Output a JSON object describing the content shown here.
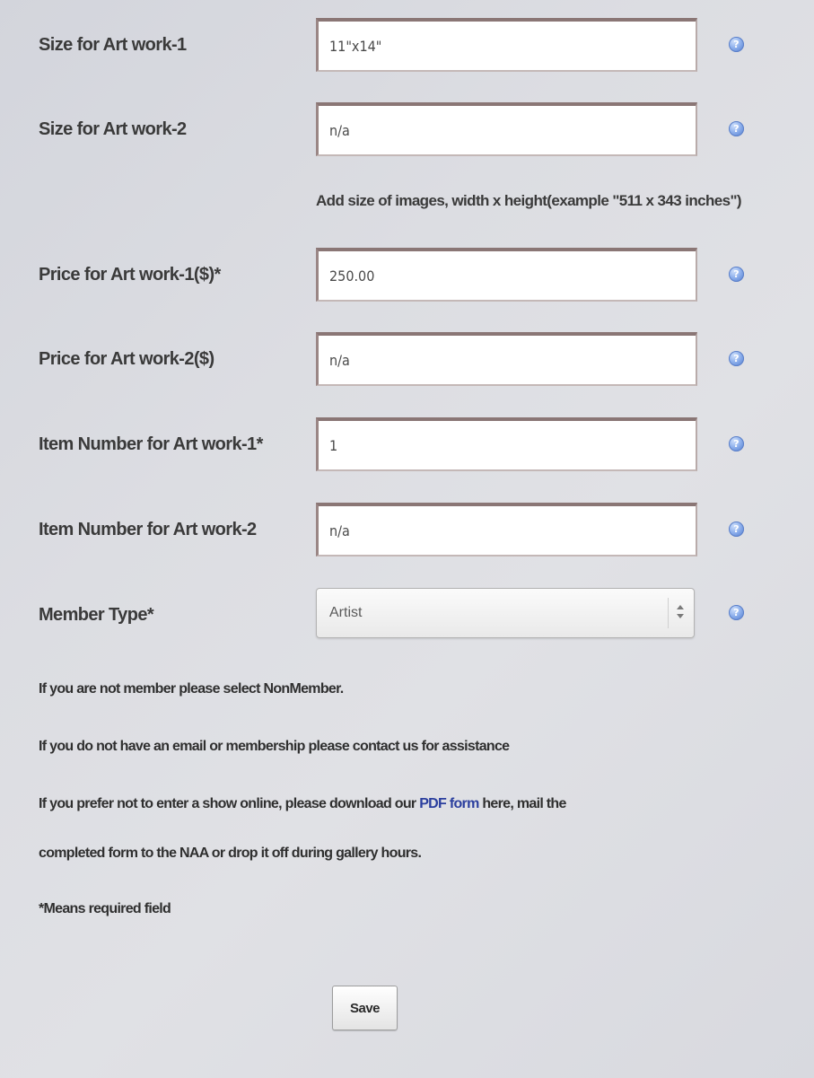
{
  "form": {
    "fields": [
      {
        "label": "Size for Art work-1",
        "value": "11\"x14\""
      },
      {
        "label": "Size for Art work-2",
        "value": "n/a"
      },
      {
        "label": "Price for Art work-1($)*",
        "value": "250.00"
      },
      {
        "label": "Price for Art work-2($)",
        "value": "n/a"
      },
      {
        "label": "Item Number for Art work-1*",
        "value": "1"
      },
      {
        "label": "Item Number for Art work-2",
        "value": "n/a"
      }
    ],
    "size_hint": "Add size of images, width x height(example \"511 x 343 inches\")",
    "member_type": {
      "label": "Member Type*",
      "selected": "Artist"
    },
    "help_icon_glyph": "?",
    "help_icon_name": "help-icon",
    "help_icon_color": "#5b85d6"
  },
  "notes": {
    "nonmember": "If you are not member please select NonMember.",
    "contact": "If you do not have an email or membership please contact us for assistance",
    "pdf_before": "If you prefer not to enter a show online, please download our ",
    "pdf_link": "PDF form",
    "pdf_after": " here, mail the",
    "pdf_line2": "completed form to the NAA or drop it off during gallery hours.",
    "required": "*Means required field"
  },
  "buttons": {
    "save_label": "Save"
  },
  "colors": {
    "link": "#2b3f9e",
    "field_border": "#8a7675",
    "text": "#3a3a3a"
  }
}
